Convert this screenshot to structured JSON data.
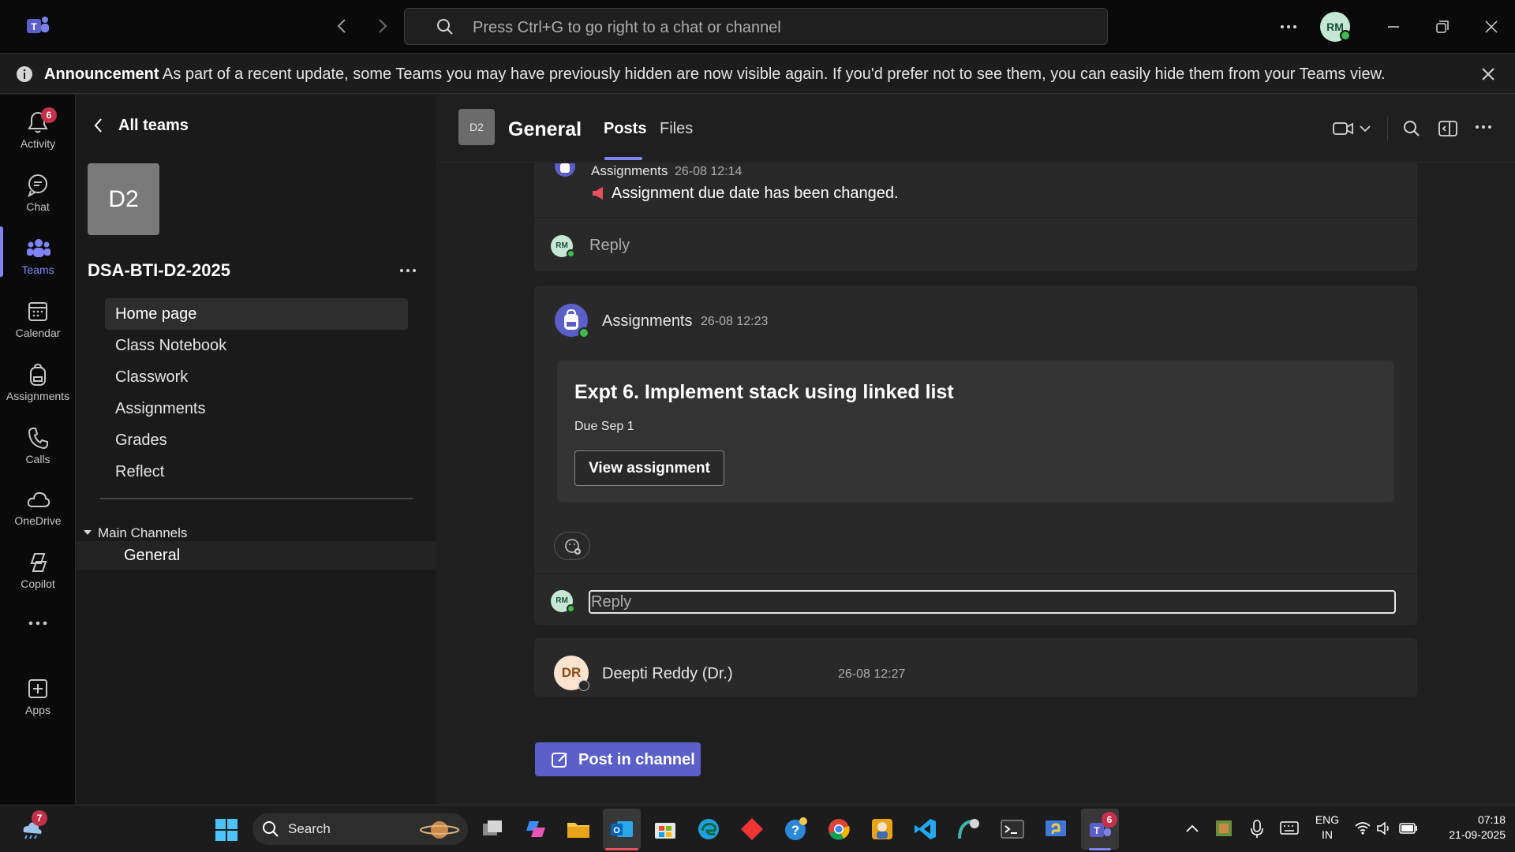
{
  "titlebar": {
    "search_placeholder": "Press Ctrl+G to go right to a chat or channel",
    "avatar_initials": "RM"
  },
  "announcement": {
    "bold": "Announcement",
    "text": "As part of a recent update, some Teams you may have previously hidden are now visible again. If you'd prefer not to see them, you can easily hide them from your Teams view."
  },
  "rail": {
    "items": [
      {
        "label": "Activity",
        "badge": "6"
      },
      {
        "label": "Chat"
      },
      {
        "label": "Teams"
      },
      {
        "label": "Calendar"
      },
      {
        "label": "Assignments"
      },
      {
        "label": "Calls"
      },
      {
        "label": "OneDrive"
      },
      {
        "label": "Copilot"
      },
      {
        "label": "Apps"
      }
    ]
  },
  "leftpanel": {
    "back_label": "All teams",
    "team_tile": "D2",
    "team_name": "DSA-BTI-D2-2025",
    "nav": [
      "Home page",
      "Class Notebook",
      "Classwork",
      "Assignments",
      "Grades",
      "Reflect"
    ],
    "channels_header": "Main Channels",
    "channel": "General"
  },
  "channel_header": {
    "tile": "D2",
    "title": "General",
    "tabs": [
      "Posts",
      "Files"
    ]
  },
  "posts": {
    "post1": {
      "author": "Assignments",
      "time": "26-08 12:14",
      "text": "Assignment due date has been changed.",
      "reply": "Reply",
      "reply_avatar": "RM"
    },
    "post2": {
      "author": "Assignments",
      "time": "26-08 12:23",
      "card_title": "Expt 6. Implement stack using linked list",
      "due": "Due Sep 1",
      "button": "View assignment",
      "reply_placeholder": "Reply",
      "reply_avatar": "RM"
    },
    "post3": {
      "author": "Deepti Reddy (Dr.)",
      "time": "26-08 12:27",
      "avatar": "DR"
    }
  },
  "post_button": "Post in channel",
  "taskbar": {
    "weather_badge": "7",
    "search": "Search",
    "teams_badge": "6",
    "lang1": "ENG",
    "lang2": "IN",
    "time": "07:18",
    "date": "21-09-2025"
  },
  "colors": {
    "accent": "#7f85f5",
    "primary_button": "#5b5fc7",
    "badge": "#c4314b"
  }
}
